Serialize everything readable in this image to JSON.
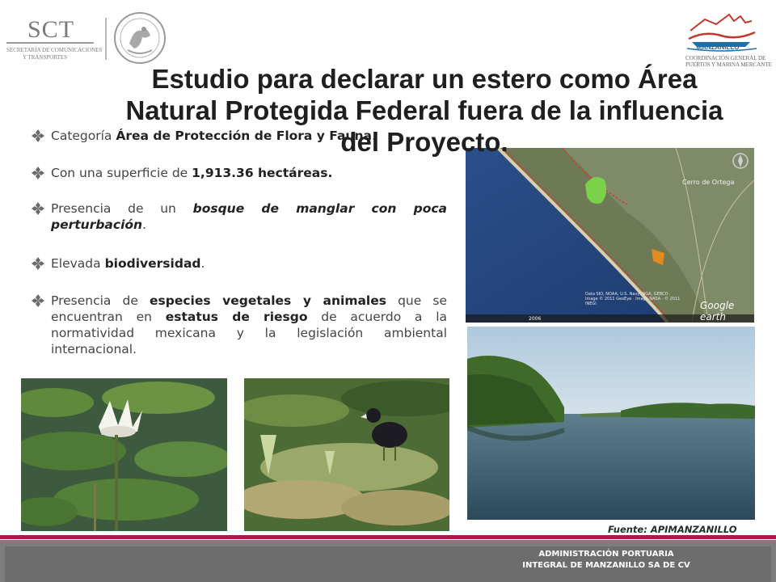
{
  "header": {
    "sct_logo_text": "SCT",
    "sct_subtitle_line1": "SECRETARÍA DE COMUNICACIONES",
    "sct_subtitle_line2": "Y TRANSPORTES",
    "seal_icon": "mexico-seal-icon",
    "port_logo_name": "MANZANILLO",
    "port_logo_subtitle_line1": "COORDINACIÓN GENERAL DE",
    "port_logo_subtitle_line2": "PUERTOS Y MARINA MERCANTE"
  },
  "slide": {
    "title": "Estudio para declarar un estero como Área Natural Protegida Federal fuera de la influencia  del Proyecto.",
    "bullets": [
      {
        "pre": "Categoría ",
        "bold": "Área de Protección de Flora y Fauna",
        "post": "."
      },
      {
        "pre": "Con una superficie de ",
        "bold": "1,913.36 hectáreas",
        "post": "."
      },
      {
        "pre": "Presencia  de un ",
        "bold": "bosque de manglar con poca perturbación",
        "post": "."
      },
      {
        "pre": "Elevada ",
        "bold": "biodiversidad",
        "post": "."
      },
      {
        "pre": "Presencia de ",
        "bold": "especies vegetales y animales",
        "mid": " que se encuentran en ",
        "bold2": "estatus de riesgo",
        "post": " de acuerdo a la normatividad mexicana y la legislación ambiental internacional."
      }
    ],
    "satellite_labels": {
      "place": "Cerro de Ortega",
      "credit": "Google earth",
      "imagery_credit": "Data SIO, NOAA, U.S. Navy, NGA, GEBCO · Image © 2011 GeoEye · Image NASA · © 2011 INEGI",
      "year": "2006"
    },
    "source_text": "Fuente: APIMANZANILLO"
  },
  "footer": {
    "line1": "ADMINISTRACIÓN PORTUARIA",
    "line2": "INTEGRAL DE MANZANILLO SA DE CV"
  },
  "colors": {
    "accent_stripe": "#b2174a",
    "footer_gray": "#7d7d7d",
    "bullet_diamond": "#6b6b6b",
    "port_logo_blue": "#1d6fa6",
    "port_logo_red": "#c0392b"
  }
}
